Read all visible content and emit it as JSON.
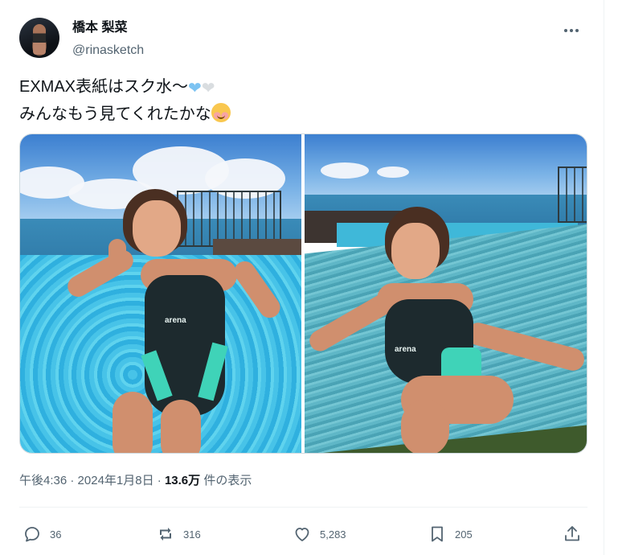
{
  "user": {
    "display_name": "橋本 梨菜",
    "handle": "@rinasketch"
  },
  "menu": {
    "icon": "more-horizontal-icon"
  },
  "tweet": {
    "line1_text": "EXMAX表紙はスク水～",
    "line1_emojis": [
      "blue-heart",
      "white-heart"
    ],
    "line2_text": "みんなもう見てくれたかな",
    "line2_emoji": "smiling-face-with-blush"
  },
  "media": {
    "photos": [
      {
        "label": "pool photo",
        "swimsuit_logo": "arena"
      },
      {
        "label": "hammock photo",
        "swimsuit_logo": "arena"
      }
    ]
  },
  "meta": {
    "time": "午後4:36",
    "separator1": " · ",
    "date": "2024年1月8日",
    "separator2": " · ",
    "views_count": "13.6万",
    "views_label": " 件の表示"
  },
  "actions": {
    "replies": "36",
    "retweets": "316",
    "likes": "5,283",
    "bookmarks": "205"
  },
  "colors": {
    "text_primary": "#0f1419",
    "text_secondary": "#536471",
    "divider": "#eff3f4"
  }
}
